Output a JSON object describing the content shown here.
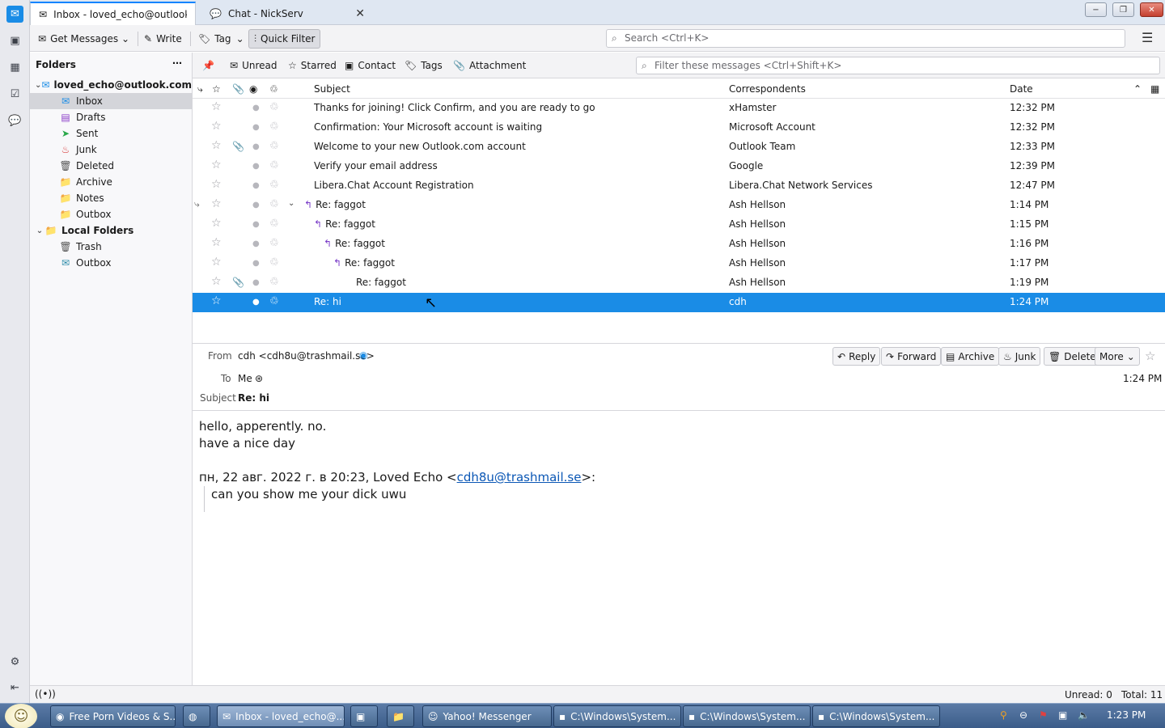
{
  "tabs": [
    {
      "label": "Inbox - loved_echo@outlook.co",
      "icon": "inbox-tab-icon"
    },
    {
      "label": "Chat - NickServ",
      "icon": "chat-tab-icon"
    }
  ],
  "window_controls": {
    "minimize": "−",
    "restore": "❐",
    "close": "✕"
  },
  "toolbar": {
    "get_messages": "Get Messages",
    "write": "Write",
    "tag": "Tag",
    "quick_filter": "Quick Filter",
    "search_placeholder": "Search <Ctrl+K>"
  },
  "folders": {
    "header": "Folders",
    "items": [
      {
        "label": "loved_echo@outlook.com",
        "icon": "account-icon",
        "glyph": "✉"
      },
      {
        "label": "Inbox",
        "icon": "inbox-icon",
        "glyph": "✉"
      },
      {
        "label": "Drafts",
        "icon": "drafts-icon",
        "glyph": "▤"
      },
      {
        "label": "Sent",
        "icon": "sent-icon",
        "glyph": "➤"
      },
      {
        "label": "Junk",
        "icon": "junk-icon",
        "glyph": "♨"
      },
      {
        "label": "Deleted",
        "icon": "trash-icon",
        "glyph": "🗑"
      },
      {
        "label": "Archive",
        "icon": "folder-icon",
        "glyph": "📁"
      },
      {
        "label": "Notes",
        "icon": "folder-icon",
        "glyph": "📁"
      },
      {
        "label": "Outbox",
        "icon": "folder-icon",
        "glyph": "📁"
      },
      {
        "label": "Local Folders",
        "icon": "local-folders-icon",
        "glyph": "📁"
      },
      {
        "label": "Trash",
        "icon": "trash-icon",
        "glyph": "🗑"
      },
      {
        "label": "Outbox",
        "icon": "outbox-icon",
        "glyph": "✉"
      }
    ]
  },
  "quick_filter": {
    "unread": "Unread",
    "starred": "Starred",
    "contact": "Contact",
    "tags": "Tags",
    "attachment": "Attachment",
    "filter_placeholder": "Filter these messages <Ctrl+Shift+K>"
  },
  "columns": {
    "subject": "Subject",
    "correspondents": "Correspondents",
    "date": "Date"
  },
  "messages": [
    {
      "subject": "Thanks for joining! Click Confirm, and you are ready to go",
      "from": "xHamster",
      "date": "12:32 PM",
      "attach": false
    },
    {
      "subject": "Confirmation: Your Microsoft account is waiting",
      "from": "Microsoft Account",
      "date": "12:32 PM",
      "attach": false
    },
    {
      "subject": "Welcome to your new Outlook.com account",
      "from": "Outlook Team",
      "date": "12:33 PM",
      "attach": true
    },
    {
      "subject": "Verify your email address",
      "from": "Google",
      "date": "12:39 PM",
      "attach": false
    },
    {
      "subject": "Libera.Chat Account Registration",
      "from": "Libera.Chat Network Services",
      "date": "12:47 PM",
      "attach": false
    },
    {
      "subject": "Re: faggot",
      "from": "Ash Hellson",
      "date": "1:14 PM",
      "attach": false
    },
    {
      "subject": "Re: faggot",
      "from": "Ash Hellson",
      "date": "1:15 PM",
      "attach": false
    },
    {
      "subject": "Re: faggot",
      "from": "Ash Hellson",
      "date": "1:16 PM",
      "attach": false
    },
    {
      "subject": "Re: faggot",
      "from": "Ash Hellson",
      "date": "1:17 PM",
      "attach": false
    },
    {
      "subject": "Re: faggot",
      "from": "Ash Hellson",
      "date": "1:19 PM",
      "attach": true
    },
    {
      "subject": "Re: hi",
      "from": "cdh",
      "date": "1:24 PM",
      "attach": false
    }
  ],
  "header": {
    "from_label": "From",
    "from_value": "cdh <cdh8u@trashmail.se>",
    "to_label": "To",
    "to_value": "Me",
    "subject_label": "Subject",
    "subject_value": "Re: hi",
    "time": "1:24 PM",
    "reply": "Reply",
    "forward": "Forward",
    "archive": "Archive",
    "junk": "Junk",
    "delete": "Delete",
    "more": "More"
  },
  "body": {
    "line1": "hello, apperently. no.",
    "line2": "have a nice day",
    "quote_intro_pre": "пн, 22 авг. 2022 г. в 20:23, Loved Echo <",
    "quote_link": "cdh8u@trashmail.se",
    "quote_intro_post": ">:",
    "quote_text": "can you show me your dick uwu"
  },
  "status": {
    "unread": "Unread: 0",
    "total": "Total: 11"
  },
  "taskbar": {
    "items": [
      {
        "label": "Free Porn Videos & S...",
        "icon": "chrome-icon"
      },
      {
        "label": "",
        "icon": "firefox-icon"
      },
      {
        "label": "Inbox - loved_echo@...",
        "icon": "thunderbird-icon"
      },
      {
        "label": "",
        "icon": "app-icon"
      },
      {
        "label": "",
        "icon": "folder-icon"
      },
      {
        "label": "Yahoo! Messenger",
        "icon": "yahoo-messenger-icon"
      },
      {
        "label": "C:\\Windows\\System...",
        "icon": "cmd-icon"
      },
      {
        "label": "C:\\Windows\\System...",
        "icon": "cmd-icon"
      },
      {
        "label": "C:\\Windows\\System...",
        "icon": "cmd-icon"
      }
    ],
    "clock": "1:23 PM"
  }
}
